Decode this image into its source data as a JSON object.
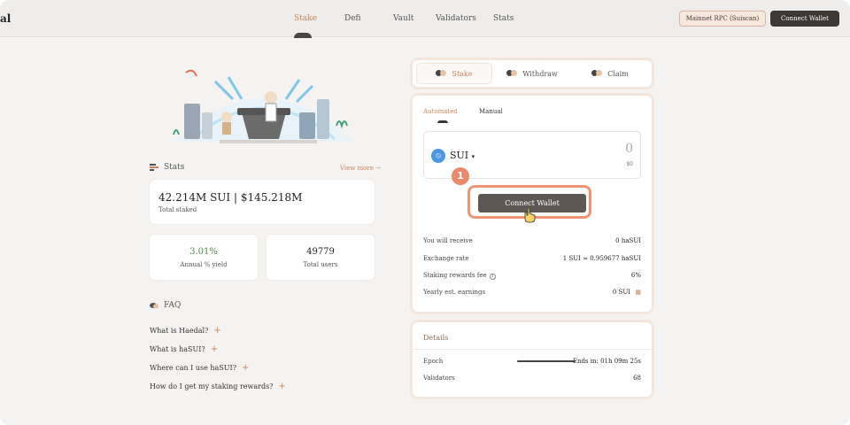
{
  "header": {
    "logo_fragment": "al",
    "nav": [
      "Stake",
      "Defi",
      "Vault",
      "Validators",
      "Stats"
    ],
    "active_nav": "Stake",
    "rpc_label": "Mainnet RPC (Suiscan)",
    "connect_wallet_label": "Connect Wallet"
  },
  "stats": {
    "heading": "Stats",
    "view_more": "View more →",
    "total_staked_value": "42.214M SUI | $145.218M",
    "total_staked_label": "Total staked",
    "apy_value": "3.01%",
    "apy_label": "Annual % yield",
    "users_value": "49779",
    "users_label": "Total users"
  },
  "faq": {
    "heading": "FAQ",
    "items": [
      "What is Haedal?",
      "What is haSUI?",
      "Where can I use haSUI?",
      "How do I get my staking rewards?"
    ]
  },
  "tabs": [
    "Stake",
    "Withdraw",
    "Claim"
  ],
  "active_tab": "Stake",
  "stake_panel": {
    "modes": [
      "Automated",
      "Manual"
    ],
    "active_mode": "Automated",
    "token": "SUI",
    "amount": "0",
    "usd": "$0",
    "step_number": "1",
    "connect_wallet_label": "Connect Wallet",
    "rows": [
      {
        "label": "You will receive",
        "value": "0 haSUI"
      },
      {
        "label": "Exchange rate",
        "value": "1 SUI ≈ 0.959677 haSUI"
      },
      {
        "label": "Staking rewards fee",
        "value": "6%"
      },
      {
        "label": "Yearly est. earnings",
        "value": "0 SUI"
      }
    ]
  },
  "details": {
    "heading": "Details",
    "epoch_label": "Epoch",
    "epoch_value": "Ends in: 01h 09m 25s",
    "validators_label": "Validators",
    "validators_value": "68"
  },
  "colors": {
    "accent": "#c8845a",
    "dark_button": "#3e3834",
    "highlight": "#ef9475",
    "apy_green": "#4f8a4f"
  }
}
